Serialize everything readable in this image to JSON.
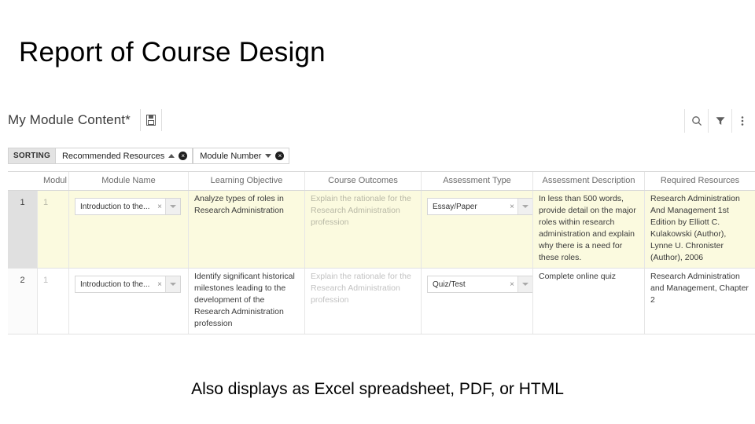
{
  "slide": {
    "title": "Report of Course Design",
    "caption": "Also displays as Excel spreadsheet, PDF, or HTML"
  },
  "app": {
    "document_title": "My Module Content*",
    "document_icon": "save-document-icon",
    "toolbar_icons": [
      "search-icon",
      "filter-funnel-icon",
      "more-vertical-icon"
    ],
    "sorting": {
      "label": "SORTING",
      "chips": [
        {
          "label": "Recommended Resources",
          "direction": "asc",
          "remove": "×"
        },
        {
          "label": "Module Number",
          "direction": "desc",
          "remove": "×"
        }
      ]
    },
    "grid": {
      "columns": [
        {
          "key": "rownum",
          "label": ""
        },
        {
          "key": "modul",
          "label": "Modul"
        },
        {
          "key": "module_name",
          "label": "Module Name"
        },
        {
          "key": "learning_objective",
          "label": "Learning Objective"
        },
        {
          "key": "course_outcomes",
          "label": "Course Outcomes"
        },
        {
          "key": "assessment_type",
          "label": "Assessment Type"
        },
        {
          "key": "assessment_description",
          "label": "Assessment Description"
        },
        {
          "key": "required_resources",
          "label": "Required Resources"
        }
      ],
      "rows": [
        {
          "rownum": "1",
          "modul": "1",
          "module_name": "Introduction to the...",
          "module_name_clear": "×",
          "learning_objective": "Analyze types of roles in Research Administration",
          "course_outcomes": "Explain the rationale for the Research Administration profession",
          "assessment_type": "Essay/Paper",
          "assessment_type_clear": "×",
          "assessment_description": "In less than 500 words, provide detail on the major roles within research administration and explain why there is a need for these roles.",
          "required_resources": "Research Administration And Management 1st Edition by Elliott C. Kulakowski (Author), Lynne U. Chronister (Author), 2006"
        },
        {
          "rownum": "2",
          "modul": "1",
          "module_name": "Introduction to the...",
          "module_name_clear": "×",
          "learning_objective": "Identify significant historical milestones leading to the development of the Research Administration profession",
          "course_outcomes": "Explain the rationale for the Research Administration profession",
          "assessment_type": "Quiz/Test",
          "assessment_type_clear": "×",
          "assessment_description": "Complete online quiz",
          "required_resources": "Research Administration and Management, Chapter 2"
        }
      ]
    }
  },
  "colors": {
    "row_highlight": "#fbfadf",
    "gutter_selected": "#e0e0e0",
    "muted_text": "#b8b8a6",
    "border": "#e2e2e2"
  }
}
